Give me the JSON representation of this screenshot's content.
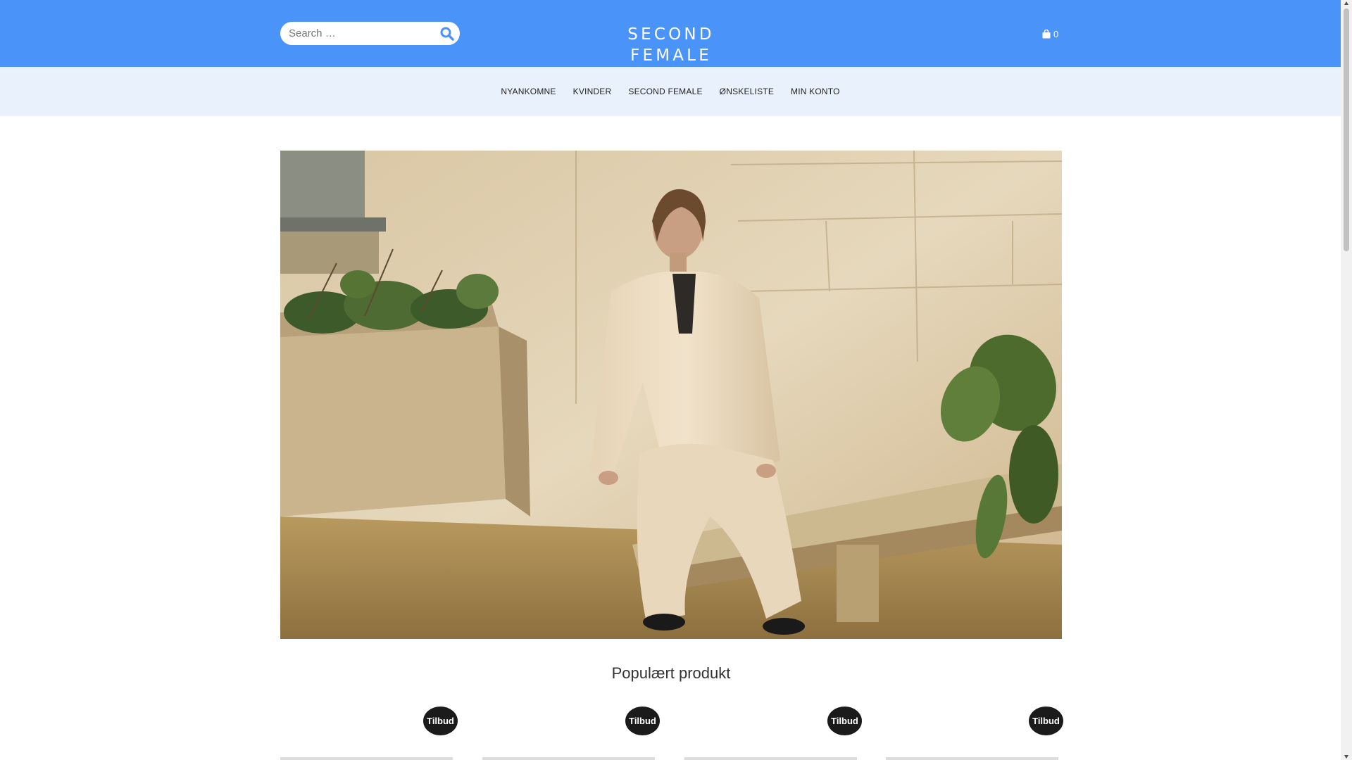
{
  "header": {
    "search": {
      "placeholder": "Search …"
    },
    "logo_text": "SECOND FEMALE",
    "cart": {
      "icon": "shopping-bag-icon",
      "count": "0"
    },
    "bg_color": "#4a94f9"
  },
  "nav": {
    "bg_color": "#e9f1fd",
    "items": [
      {
        "label": "NYANKOMNE"
      },
      {
        "label": "KVINDER"
      },
      {
        "label": "SECOND FEMALE"
      },
      {
        "label": "ØNSKELISTE"
      },
      {
        "label": "MIN KONTO"
      }
    ]
  },
  "hero": {
    "image": "woman-in-cream-linen-suit-on-stone-bench"
  },
  "main": {
    "section_title": "Populært produkt",
    "products": [
      {
        "badge": "Tilbud"
      },
      {
        "badge": "Tilbud"
      },
      {
        "badge": "Tilbud"
      },
      {
        "badge": "Tilbud"
      }
    ]
  }
}
